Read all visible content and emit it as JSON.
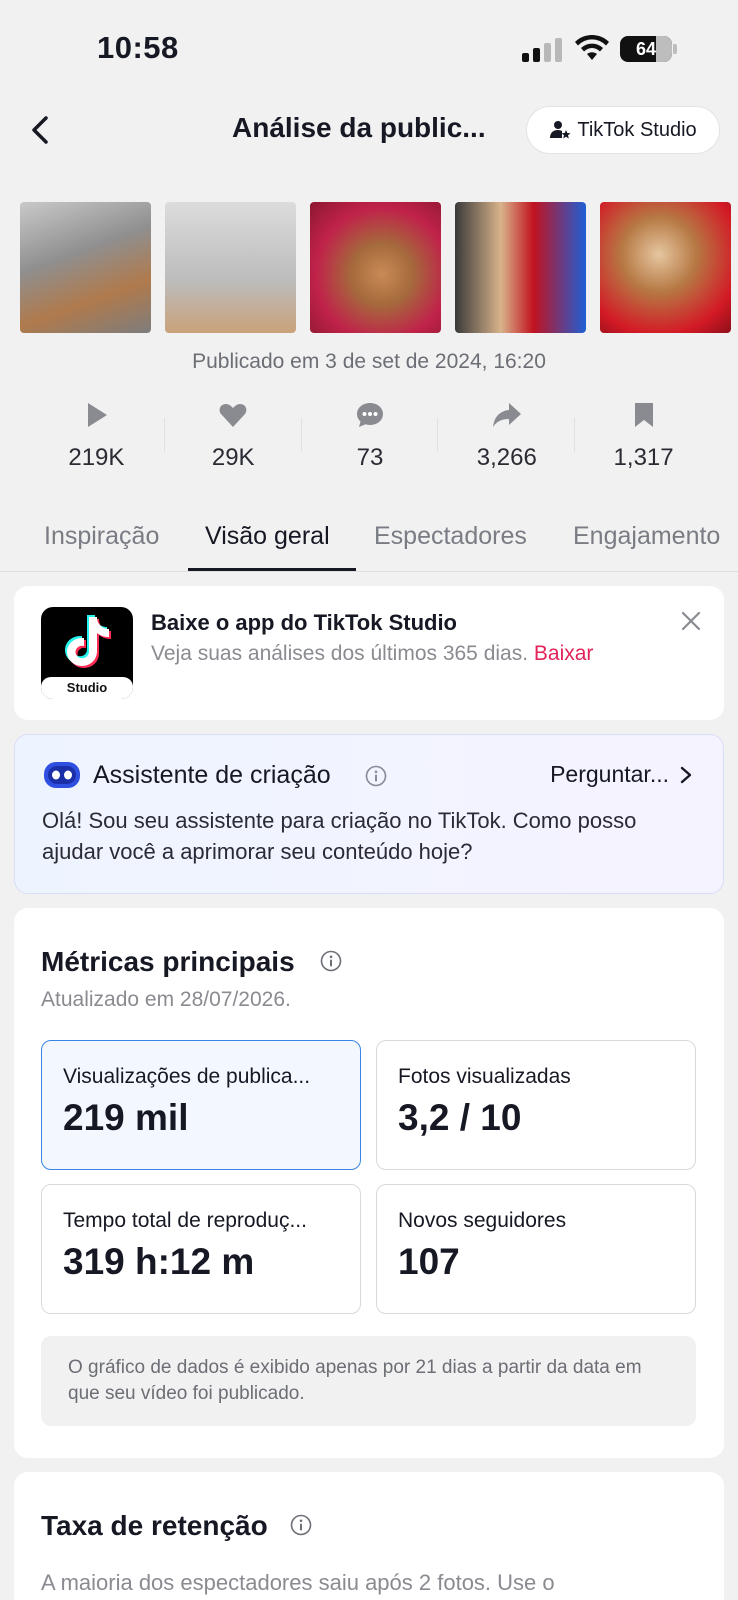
{
  "status_bar": {
    "time": "10:58",
    "battery": "64"
  },
  "header": {
    "title": "Análise da public...",
    "studio_button": "TikTok Studio"
  },
  "post": {
    "published": "Publicado em 3 de set de 2024, 16:20",
    "stats": {
      "plays": "219K",
      "likes": "29K",
      "comments": "73",
      "shares": "3,266",
      "saves": "1,317"
    }
  },
  "tabs": [
    "Inspiração",
    "Visão geral",
    "Espectadores",
    "Engajamento"
  ],
  "download_banner": {
    "icon_label": "Studio",
    "title": "Baixe o app do TikTok Studio",
    "subtitle": "Veja suas análises dos últimos 365 dias.",
    "link": "Baixar"
  },
  "assistant": {
    "title": "Assistente de criação",
    "ask": "Perguntar...",
    "body": "Olá! Sou seu assistente para criação no TikTok. Como posso ajudar você a aprimorar seu conteúdo hoje?"
  },
  "metrics": {
    "title": "Métricas principais",
    "updated": "Atualizado em 28/07/2026.",
    "cards": [
      {
        "label": "Visualizações de publica...",
        "value": "219 mil"
      },
      {
        "label": "Fotos visualizadas",
        "value": "3,2 / 10"
      },
      {
        "label": "Tempo total de reproduç...",
        "value": "319 h:12 m"
      },
      {
        "label": "Novos seguidores",
        "value": "107"
      }
    ],
    "note": "O gráfico de dados é exibido apenas por 21 dias a partir da data em que seu vídeo foi publicado."
  },
  "retention": {
    "title": "Taxa de retenção",
    "subtitle": "A maioria dos espectadores saiu após 2 fotos. Use o"
  },
  "colors": {
    "accent": "#e3245a",
    "selected_border": "#3a86e6",
    "background": "#f1f1f2"
  }
}
